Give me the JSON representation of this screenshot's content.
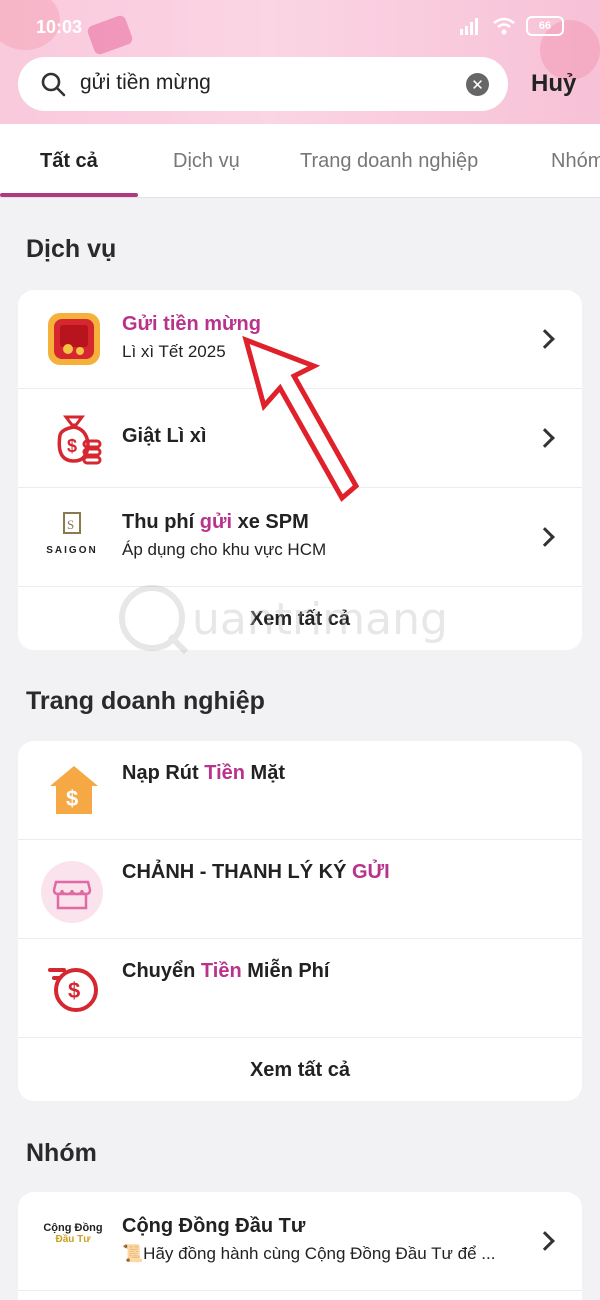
{
  "status_bar": {
    "time": "10:03",
    "battery": "66"
  },
  "search": {
    "query": "gửi tiền mừng",
    "cancel_label": "Huỷ"
  },
  "tabs": [
    {
      "label": "Tất cả"
    },
    {
      "label": "Dịch vụ"
    },
    {
      "label": "Trang doanh nghiệp"
    },
    {
      "label": "Nhóm"
    }
  ],
  "services": {
    "title": "Dịch vụ",
    "items": [
      {
        "title_hl": "Gửi tiền mừng",
        "subtitle": "Lì xì Tết 2025",
        "icon": "red-envelope-icon"
      },
      {
        "title": "Giật Lì xì",
        "icon": "money-bag-icon"
      },
      {
        "title_pre": "Thu phí ",
        "title_hl": "gửi",
        "title_post": " xe SPM",
        "subtitle": "Áp dụng cho khu vực HCM",
        "icon": "saigon-logo-icon",
        "logo_text": "SAIGON"
      }
    ],
    "see_all": "Xem tất cả"
  },
  "business": {
    "title": "Trang doanh nghiệp",
    "items": [
      {
        "title_pre": "Nạp Rút ",
        "title_hl": "Tiền",
        "title_post": " Mặt",
        "icon": "house-dollar-icon"
      },
      {
        "title_pre": "CHẢNH - THANH LÝ KÝ ",
        "title_hl": "GỬI",
        "icon": "store-icon"
      },
      {
        "title_pre": "Chuyển ",
        "title_hl": "Tiền",
        "title_post": " Miễn Phí",
        "icon": "transfer-dollar-icon"
      }
    ],
    "see_all": "Xem tất cả"
  },
  "groups": {
    "title": "Nhóm",
    "items": [
      {
        "title": "Cộng Đồng Đầu Tư",
        "subtitle": "📜Hãy đồng hành cùng Cộng Đồng Đầu Tư để ...",
        "logo_line1": "Cộng Đồng",
        "logo_line2": "Đầu Tư",
        "icon": "group-logo-icon"
      }
    ]
  },
  "watermark": "uantrimang",
  "colors": {
    "accent": "#b8338b",
    "tab_underline": "#b03a82",
    "header_pink": "#f9c9dc",
    "annotation_red": "#e0202a"
  }
}
